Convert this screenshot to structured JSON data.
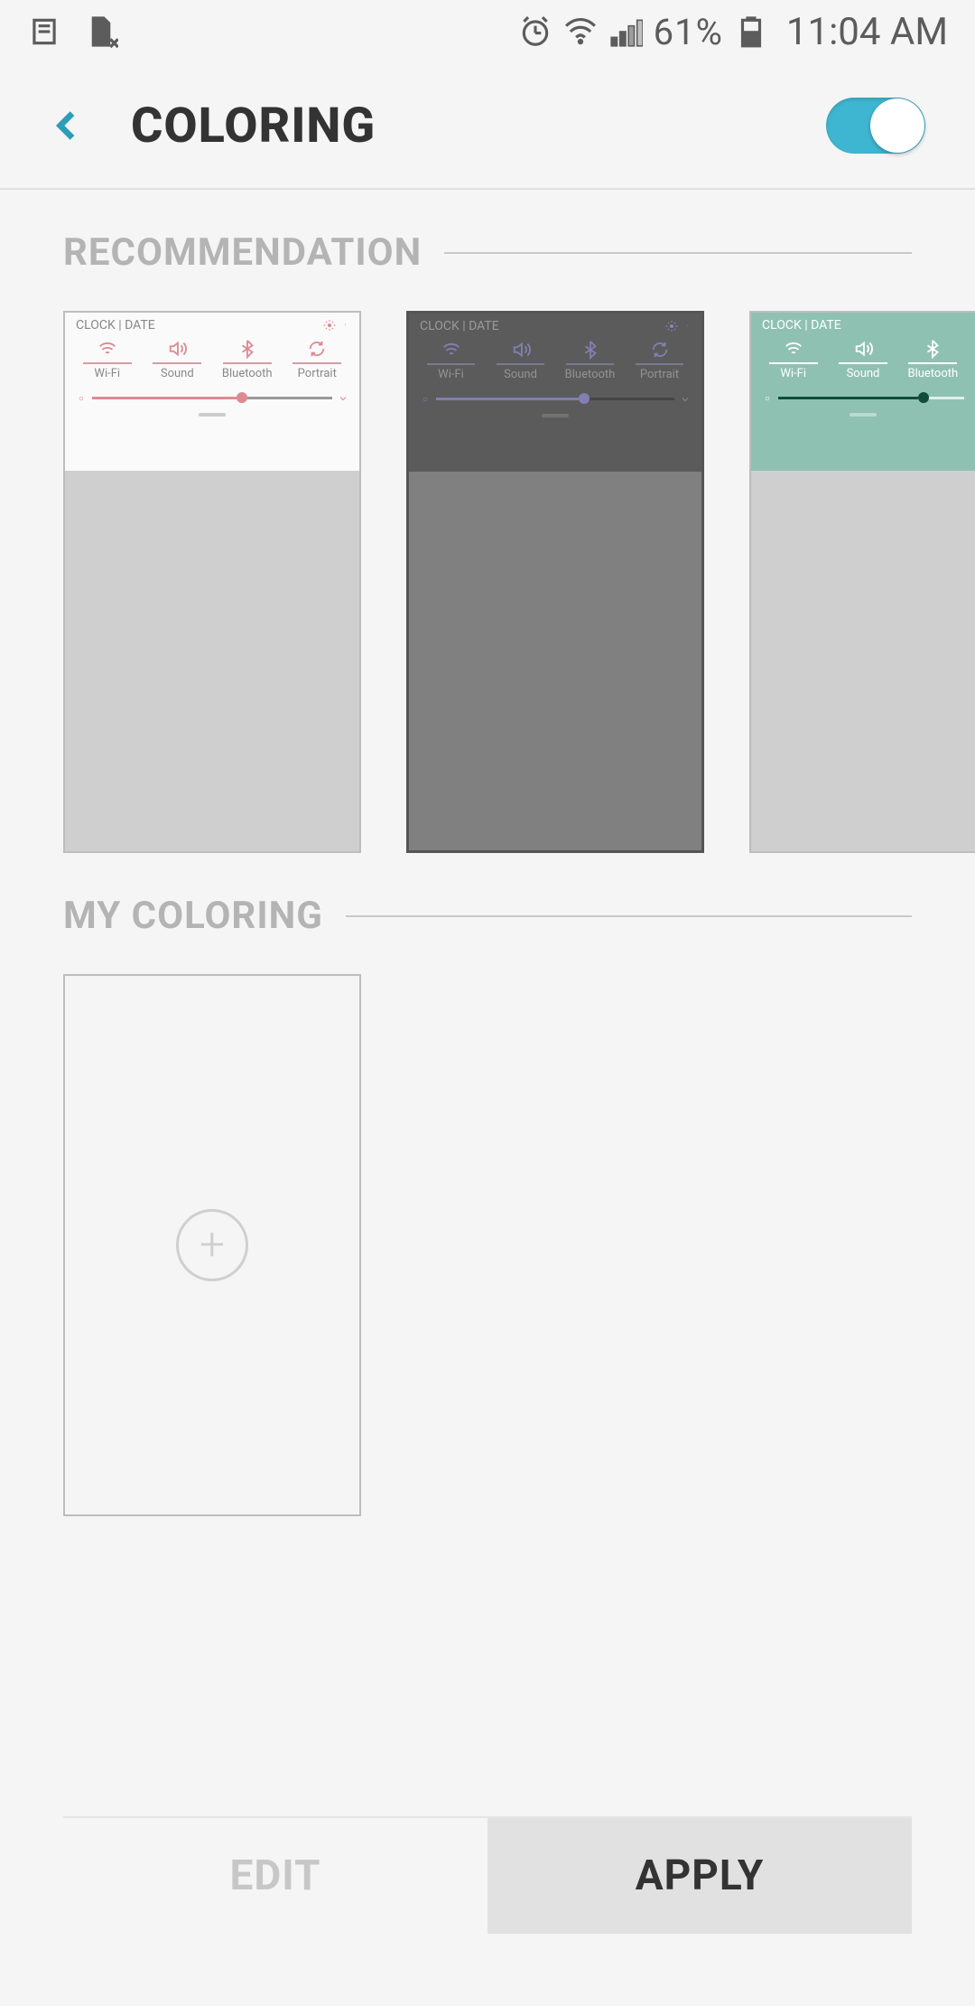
{
  "status_bar": {
    "battery_percent": "61%",
    "time": "11:04 AM"
  },
  "header": {
    "title": "COLORING",
    "toggle_on": true
  },
  "sections": {
    "recommendation": "RECOMMENDATION",
    "my_coloring": "MY COLORING"
  },
  "qs_panel": {
    "clock_date": "CLOCK | DATE",
    "items": [
      {
        "label": "Wi-Fi"
      },
      {
        "label": "Sound"
      },
      {
        "label": "Bluetooth"
      },
      {
        "label": "Portrait"
      }
    ]
  },
  "recommendation_themes": [
    {
      "id": "light",
      "selected": false
    },
    {
      "id": "dark",
      "selected": true
    },
    {
      "id": "green",
      "selected": false
    }
  ],
  "footer": {
    "edit": "EDIT",
    "apply": "APPLY"
  }
}
